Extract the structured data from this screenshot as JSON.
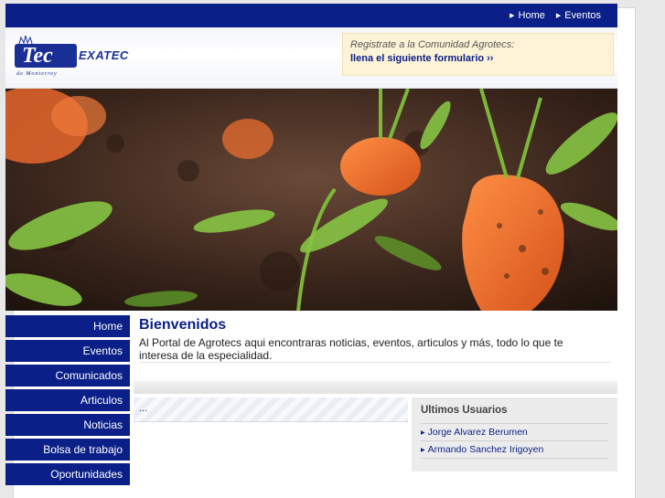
{
  "topnav": {
    "links": [
      {
        "label": "Home",
        "icon": "arrow-right-icon"
      },
      {
        "label": "Eventos",
        "icon": "arrow-right-icon"
      }
    ]
  },
  "header": {
    "logo": {
      "word": "Tec",
      "suffix": "EXATEC",
      "subtitle": "de Monterrey"
    },
    "promo": {
      "text": "Registrate a la Comunidad Agrotecs:",
      "link": "llena el siguiente formulario ››"
    }
  },
  "banner": {
    "alt": "carrots-in-soil-photo"
  },
  "sidebar": {
    "items": [
      {
        "label": "Home"
      },
      {
        "label": "Eventos"
      },
      {
        "label": "Comunicados"
      },
      {
        "label": "Articulos"
      },
      {
        "label": "Noticias"
      },
      {
        "label": "Bolsa de trabajo"
      },
      {
        "label": "Oportunidades"
      }
    ]
  },
  "main": {
    "title": "Bienvenidos",
    "body": "Al Portal de Agrotecs aqui encontraras noticias, eventos, articulos y más, todo lo que te interesa de la especialidad.",
    "news_placeholder": "..."
  },
  "users": {
    "title": "Ultimos Usuarios",
    "items": [
      {
        "name": "Jorge Alvarez Berumen"
      },
      {
        "name": "Armando Sanchez Irigoyen"
      }
    ]
  },
  "colors": {
    "primary": "#0a1f87",
    "promo_bg": "#fdf3d7"
  }
}
